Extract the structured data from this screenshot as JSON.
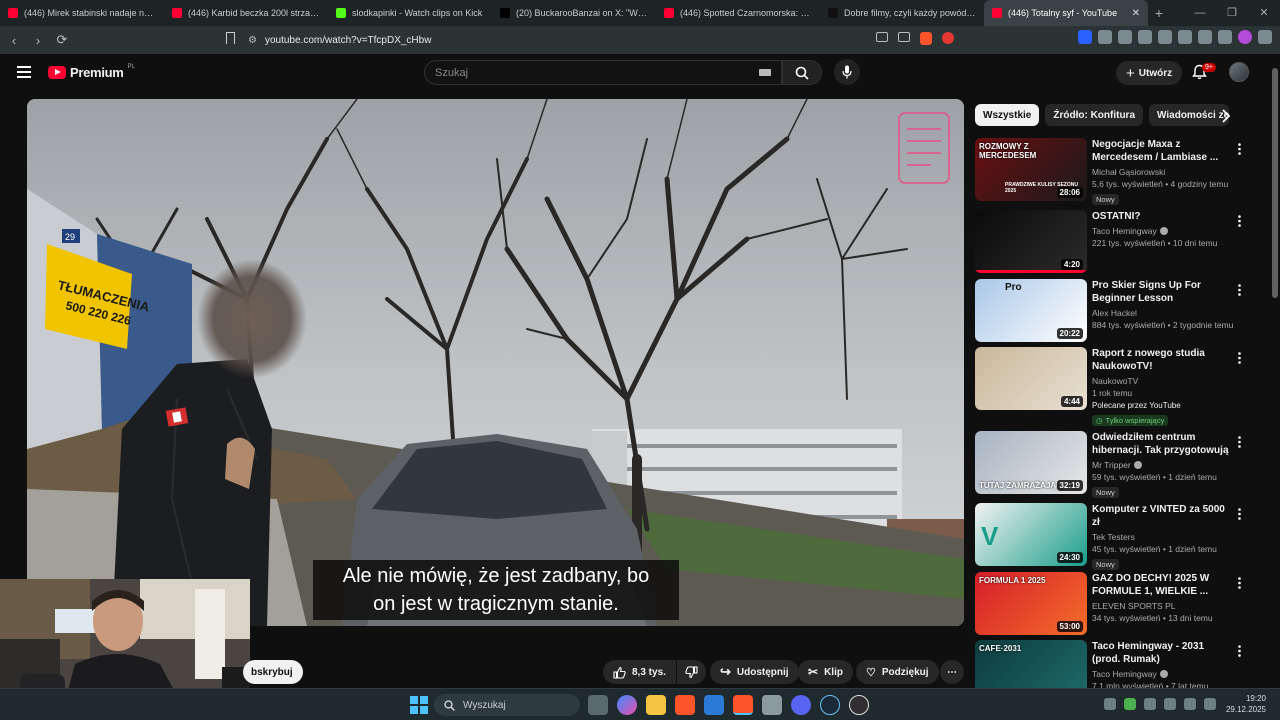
{
  "browser": {
    "tabs": [
      {
        "title": "(446) Mirek stabinski nadaje na żywo",
        "icon": "youtube-icon",
        "color": "#ff0033"
      },
      {
        "title": "(446) Karbid beczka 200l strzał 1 - Yo",
        "icon": "youtube-icon",
        "color": "#ff0033"
      },
      {
        "title": "slodkapinki - Watch clips on Kick",
        "icon": "kick-icon",
        "color": "#53fc18"
      },
      {
        "title": "(20) BuckarooBanzai on X: \"W Sankt",
        "icon": "x-icon",
        "color": "#000000"
      },
      {
        "title": "(446) Spotted Czarnomorska: upośle",
        "icon": "youtube-icon",
        "color": "#ff0033"
      },
      {
        "title": "Dobre filmy, czyli każdy powód dobr",
        "icon": "tiktok-icon",
        "color": "#111111"
      },
      {
        "title": "(446) Totalny syf - YouTube",
        "icon": "youtube-icon",
        "color": "#ff0033",
        "active": true
      }
    ],
    "url": "youtube.com/watch?v=TfcpDX_cHbw",
    "new_tab": "+",
    "close_tab": "✕"
  },
  "youtube": {
    "logo_text": "Premium",
    "logo_region": "PL",
    "search_placeholder": "Szukaj",
    "create_label": "Utwórz",
    "notifications_badge": "9+"
  },
  "video": {
    "subtitle_line1": "Ale nie mówię, że jest zadbany, bo",
    "subtitle_line2": "on jest w tragicznym stanie.",
    "sign_text": "TŁUMACZENIA",
    "sign_phone": "500 220 226",
    "building_number": "29"
  },
  "actions": {
    "subscribe_label": "bskrybuj",
    "likes": "8,3 tys.",
    "share": "Udostępnij",
    "clip": "Klip",
    "thanks": "Podziękuj",
    "more": "⋯"
  },
  "chips": [
    "Wszystkie",
    "Źródło: Konfitura",
    "Wiadomości ze ś"
  ],
  "recommendations": [
    {
      "title": "Negocjacje Maxa z Mercedesem / Lambiase ...",
      "channel": "Michał Gąsiorowski",
      "views": "5,6 tys. wyświetleń • 4 godziny temu",
      "duration": "28:06",
      "badge": "Nowy",
      "verified": false,
      "thumb_text": "ROZMOWY Z MERCEDESEM",
      "thumb_sub": "PRAWDZIWE KULISY SEZONU 2025",
      "colors": [
        "#6b0f12",
        "#1a1a1a"
      ]
    },
    {
      "title": "OSTATNI?",
      "channel": "Taco Hemingway",
      "views": "221 tys. wyświetleń • 10 dni temu",
      "duration": "4:20",
      "badge": "",
      "verified": true,
      "colors": [
        "#0b0b0b",
        "#2b2b2b"
      ],
      "progress": 1.0
    },
    {
      "title": "Pro Skier Signs Up For Beginner Lesson",
      "channel": "Alex Hackel",
      "views": "884 tys. wyświetleń • 2 tygodnie temu",
      "duration": "20:22",
      "badge": "",
      "verified": false,
      "thumb_text": "Pro",
      "colors": [
        "#a9c7e8",
        "#ffffff"
      ]
    },
    {
      "title": "Raport z nowego studia NaukowoTV!",
      "channel": "NaukowoTV",
      "views": "1 rok temu",
      "duration": "4:44",
      "badge": "",
      "verified": false,
      "extra": "Polecane przez YouTube",
      "members": "Tylko wspierający",
      "colors": [
        "#c9b79a",
        "#e8e0d2"
      ]
    },
    {
      "title": "Odwiedziłem centrum hibernacji. Tak przygotowują ...",
      "channel": "Mr Tripper",
      "views": "59 tys. wyświetleń • 1 dzień temu",
      "duration": "32:19",
      "badge": "Nowy",
      "verified": true,
      "thumb_text": "TUTAJ ZAMRAŻAJĄ L",
      "colors": [
        "#a7b4c2",
        "#e6e6e6"
      ]
    },
    {
      "title": "Komputer z VINTED za 5000 zł",
      "channel": "Tek Testers",
      "views": "45 tys. wyświetleń • 1 dzień temu",
      "duration": "24:30",
      "badge": "Nowy",
      "verified": false,
      "thumb_text": "V",
      "colors": [
        "#f2f2f2",
        "#1a9e8a"
      ]
    },
    {
      "title": "GAZ DO DECHY! 2025 W FORMULE 1, WIELKIE ...",
      "channel": "ELEVEN SPORTS PL",
      "views": "34 tys. wyświetleń • 13 dni temu",
      "duration": "53:00",
      "badge": "",
      "verified": false,
      "thumb_text": "FORMULA 1 2025",
      "colors": [
        "#d61e2a",
        "#f36d2a"
      ]
    },
    {
      "title": "Taco Hemingway - 2031 (prod. Rumak)",
      "channel": "Taco Hemingway",
      "views": "7,1 mln wyświetleń • 7 lat temu",
      "duration": "",
      "badge": "",
      "verified": true,
      "thumb_text": "CAFE·2031",
      "colors": [
        "#0d3b3e",
        "#1e6b6a"
      ]
    }
  ],
  "taskbar": {
    "search_placeholder": "Wyszukaj",
    "time": "19:20",
    "date": "29.12.2025"
  }
}
